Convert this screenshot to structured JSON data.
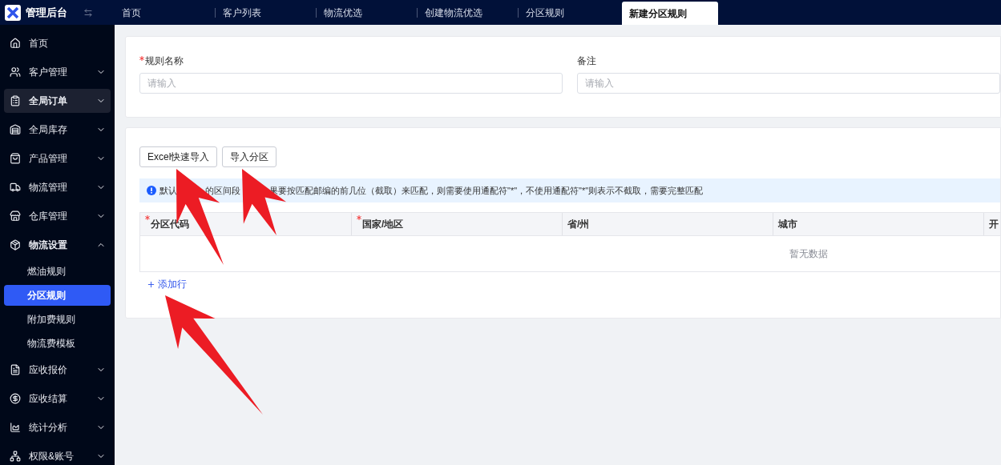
{
  "app": {
    "title": "管理后台"
  },
  "tabs": [
    {
      "label": "首页",
      "selected": false
    },
    {
      "label": "客户列表",
      "selected": false
    },
    {
      "label": "物流优选",
      "selected": false
    },
    {
      "label": "创建物流优选",
      "selected": false
    },
    {
      "label": "分区规则",
      "selected": false
    },
    {
      "label": "新建分区规则",
      "selected": true
    }
  ],
  "sidebar": {
    "items": [
      {
        "label": "首页",
        "selected": false
      },
      {
        "label": "客户管理",
        "selected": false,
        "expanded": false
      },
      {
        "label": "全局订单",
        "selected": true,
        "expanded": false
      },
      {
        "label": "全局库存",
        "selected": false,
        "expanded": false
      },
      {
        "label": "产品管理",
        "selected": false,
        "expanded": false
      },
      {
        "label": "物流管理",
        "selected": false,
        "expanded": false
      },
      {
        "label": "仓库管理",
        "selected": false,
        "expanded": false
      },
      {
        "label": "物流设置",
        "selected": false,
        "expanded": true,
        "children": [
          {
            "label": "燃油规则",
            "selected": false
          },
          {
            "label": "分区规则",
            "selected": true
          },
          {
            "label": "附加费规则",
            "selected": false
          },
          {
            "label": "物流费模板",
            "selected": false
          }
        ]
      },
      {
        "label": "应收报价",
        "selected": false,
        "expanded": false
      },
      {
        "label": "应收结算",
        "selected": false,
        "expanded": false
      },
      {
        "label": "统计分析",
        "selected": false,
        "expanded": false
      },
      {
        "label": "权限&账号",
        "selected": false,
        "expanded": false
      }
    ]
  },
  "form": {
    "fields": [
      {
        "label": "规则名称",
        "required": true,
        "placeholder": "请输入"
      },
      {
        "label": "备注",
        "required": false,
        "placeholder": "请输入"
      }
    ]
  },
  "buttons": [
    "Excel快速导入",
    "导入分区"
  ],
  "notice": {
    "fragments": [
      "默认",
      "的区间段",
      "果要按匹配邮编的前几位（截取）来匹配，则需要使用通配符\"*\"，不使用通配符\"*\"则表示不截取，需要完整匹配"
    ]
  },
  "table": {
    "columns": [
      {
        "label": "分区代码",
        "required": true
      },
      {
        "label": "国家/地区",
        "required": true
      },
      {
        "label": "省/州",
        "required": false
      },
      {
        "label": "城市",
        "required": false
      },
      {
        "label": "开",
        "required": false
      }
    ],
    "empty_text": "暂无数据"
  },
  "add_row": "添加行"
}
